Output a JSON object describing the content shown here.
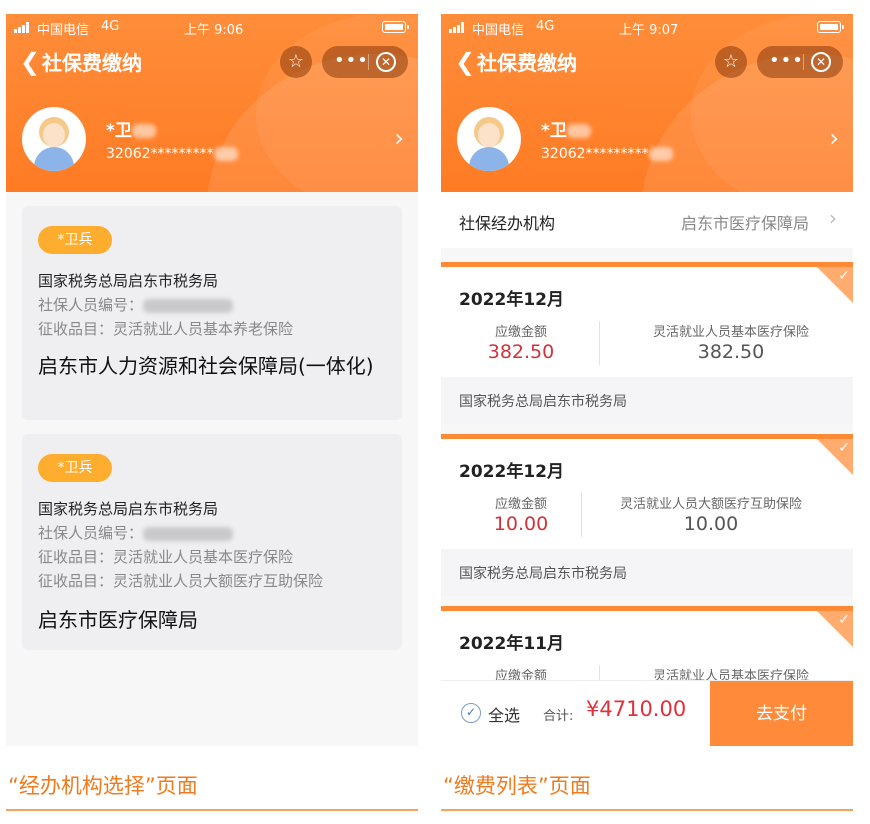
{
  "left": {
    "status": {
      "carrier": "中国电信",
      "network": "4G",
      "time": "上午 9:06"
    },
    "title": "社保费缴纳",
    "user": {
      "name": "*卫",
      "id_number": "32062*********"
    },
    "cards": [
      {
        "tag": "*卫兵",
        "tax_office": "国家税务总局启东市税务局",
        "social_no_label": "社保人员编号：",
        "items": [
          "征收品目：灵活就业人员基本养老保险"
        ],
        "bureau": "启东市人力资源和社会保障局(一体化)"
      },
      {
        "tag": "*卫兵",
        "tax_office": "国家税务总局启东市税务局",
        "social_no_label": "社保人员编号：",
        "items": [
          "征收品目：灵活就业人员基本医疗保险",
          "征收品目：灵活就业人员大额医疗互助保险"
        ],
        "bureau": "启东市医疗保障局"
      }
    ],
    "caption": "“经办机构选择”页面"
  },
  "right": {
    "status": {
      "carrier": "中国电信",
      "network": "4G",
      "time": "上午 9:07"
    },
    "title": "社保费缴纳",
    "user": {
      "name": "*卫",
      "id_number": "32062*********"
    },
    "agency": {
      "label": "社保经办机构",
      "value": "启东市医疗保障局"
    },
    "payments": [
      {
        "period": "2022年12月",
        "amount_label": "应缴金额",
        "amount": "382.50",
        "item_label": "灵活就业人员基本医疗保险",
        "item_amount": "382.50",
        "org": "国家税务总局启东市税务局"
      },
      {
        "period": "2022年12月",
        "amount_label": "应缴金额",
        "amount": "10.00",
        "item_label": "灵活就业人员大额医疗互助保险",
        "item_amount": "10.00",
        "org": "国家税务总局启东市税务局"
      },
      {
        "period": "2022年11月",
        "amount_label": "应缴金额",
        "amount": "",
        "item_label": "灵活就业人员基本医疗保险",
        "item_amount": "",
        "org": ""
      }
    ],
    "paybar": {
      "select_all": "全选",
      "total_label": "合计:",
      "total": "¥4710.00",
      "pay_button": "去支付"
    },
    "caption": "“缴费列表”页面"
  },
  "colors": {
    "accent": "#ff8a36",
    "amount_red": "#d0343a",
    "tag": "#ffad2e",
    "caption": "#f07a1e"
  }
}
